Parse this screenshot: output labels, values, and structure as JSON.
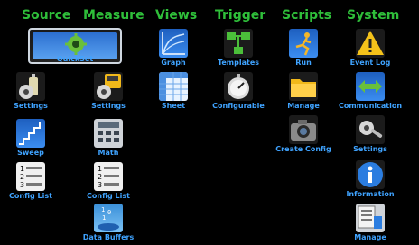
{
  "menu": {
    "headers": [
      "Source",
      "Measure",
      "Views",
      "Trigger",
      "Scripts",
      "System"
    ],
    "source": {
      "quickset": "QuickSet",
      "settings": "Settings",
      "sweep": "Sweep",
      "config_list": "Config List"
    },
    "measure": {
      "settings": "Settings",
      "math": "Math",
      "config_list": "Config List",
      "data_buffers": "Data Buffers"
    },
    "views": {
      "graph": "Graph",
      "sheet": "Sheet"
    },
    "trigger": {
      "templates": "Templates",
      "configurable": "Configurable"
    },
    "scripts": {
      "run": "Run",
      "manage": "Manage",
      "create_config": "Create Config"
    },
    "system": {
      "event_log": "Event Log",
      "communication": "Communication",
      "settings": "Settings",
      "information": "Information",
      "manage": "Manage"
    }
  }
}
